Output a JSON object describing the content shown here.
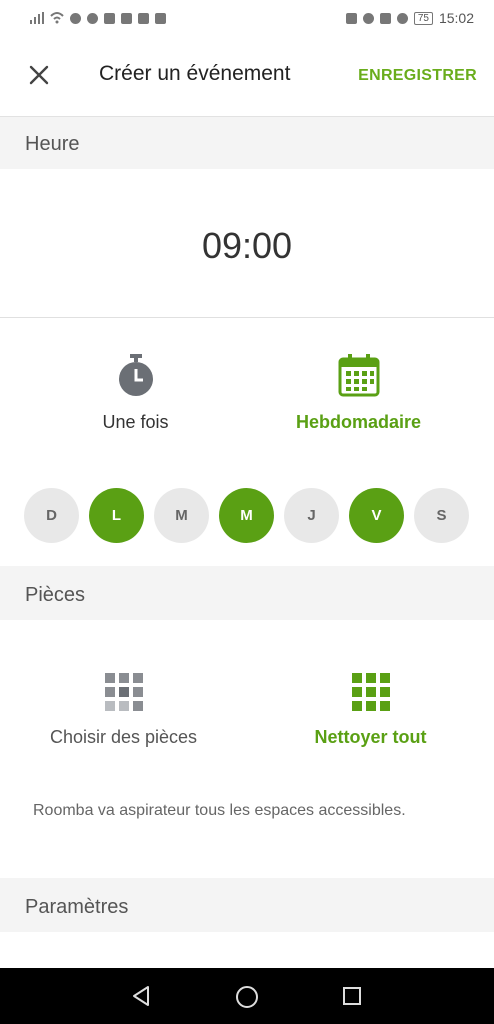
{
  "status_bar": {
    "battery": "75",
    "time": "15:02"
  },
  "header": {
    "title": "Créer un événement",
    "save_label": "ENREGISTRER"
  },
  "sections": {
    "time": "Heure",
    "rooms": "Pièces",
    "settings": "Paramètres"
  },
  "time_value": "09:00",
  "frequency": {
    "once": "Une fois",
    "weekly": "Hebdomadaire",
    "selected": "weekly"
  },
  "days": [
    {
      "label": "D",
      "selected": false
    },
    {
      "label": "L",
      "selected": true
    },
    {
      "label": "M",
      "selected": false
    },
    {
      "label": "M",
      "selected": true
    },
    {
      "label": "J",
      "selected": false
    },
    {
      "label": "V",
      "selected": true
    },
    {
      "label": "S",
      "selected": false
    }
  ],
  "rooms": {
    "choose": "Choisir des pièces",
    "clean_all": "Nettoyer tout",
    "selected": "clean_all",
    "note": "Roomba va aspirateur tous les espaces accessibles."
  },
  "colors": {
    "accent": "#5aa014",
    "icon_gray": "#6b6f75"
  },
  "icons": {
    "close": "close-icon",
    "timer": "timer-icon",
    "calendar": "calendar-icon",
    "rooms_grid": "grid-icon",
    "back": "back-triangle-icon",
    "home": "home-circle-icon",
    "recents": "recents-square-icon"
  }
}
